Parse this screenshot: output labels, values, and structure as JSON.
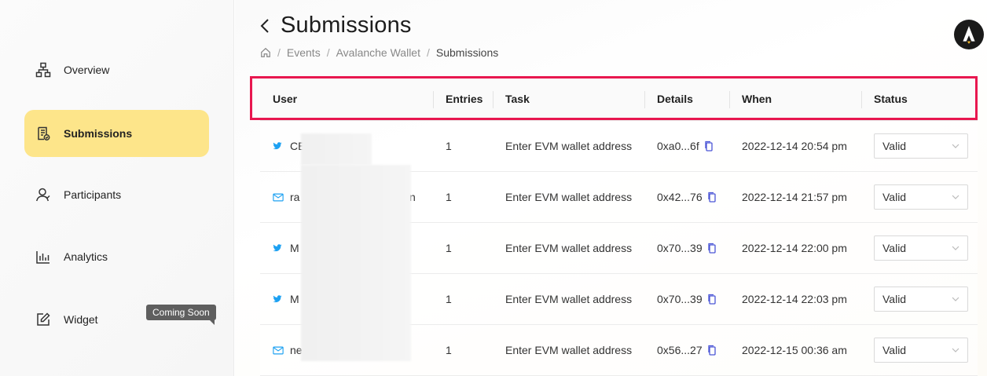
{
  "sidebar": {
    "items": [
      {
        "label": "Overview",
        "icon": "sitemap-icon",
        "active": false
      },
      {
        "label": "Submissions",
        "icon": "submissions-icon",
        "active": true
      },
      {
        "label": "Participants",
        "icon": "participants-icon",
        "active": false
      },
      {
        "label": "Analytics",
        "icon": "bar-chart-icon",
        "active": false
      },
      {
        "label": "Widget",
        "icon": "edit-icon",
        "active": false
      }
    ],
    "widget_badge": "Coming Soon"
  },
  "header": {
    "title": "Submissions",
    "breadcrumb": [
      "Events",
      "Avalanche Wallet",
      "Submissions"
    ]
  },
  "table": {
    "columns": [
      "User",
      "Entries",
      "Task",
      "Details",
      "When",
      "Status"
    ],
    "rows": [
      {
        "user_type": "twitter",
        "user": "CE",
        "entries": "1",
        "task": "Enter EVM wallet address",
        "details": "0xa0...6f",
        "when": "2022-12-14 20:54 pm",
        "status": "Valid"
      },
      {
        "user_type": "email",
        "user": "ra",
        "user_end": "n",
        "entries": "1",
        "task": "Enter EVM wallet address",
        "details": "0x42...76",
        "when": "2022-12-14 21:57 pm",
        "status": "Valid"
      },
      {
        "user_type": "twitter",
        "user": "M",
        "entries": "1",
        "task": "Enter EVM wallet address",
        "details": "0x70...39",
        "when": "2022-12-14 22:00 pm",
        "status": "Valid"
      },
      {
        "user_type": "twitter",
        "user": "M",
        "entries": "1",
        "task": "Enter EVM wallet address",
        "details": "0x70...39",
        "when": "2022-12-14 22:03 pm",
        "status": "Valid"
      },
      {
        "user_type": "email",
        "user": "ne",
        "entries": "1",
        "task": "Enter EVM wallet address",
        "details": "0x56...27",
        "when": "2022-12-15 00:36 am",
        "status": "Valid"
      }
    ]
  },
  "colors": {
    "active_nav": "#fde58a",
    "highlight": "#e8174f",
    "twitter": "#1da1f2",
    "copy_icon": "#4a55d6"
  }
}
